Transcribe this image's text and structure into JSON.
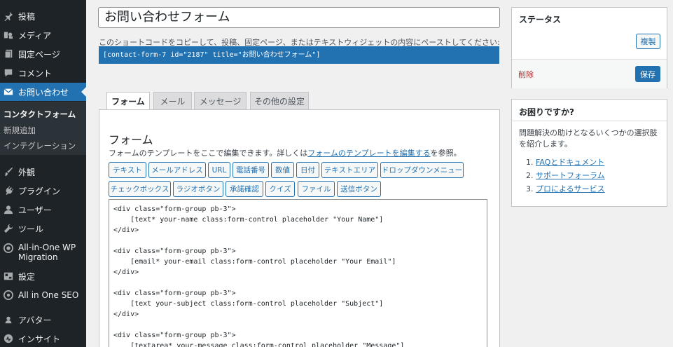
{
  "sidebar": {
    "items": [
      {
        "label": "投稿",
        "icon": "pin-icon"
      },
      {
        "label": "メディア",
        "icon": "media-icon"
      },
      {
        "label": "固定ページ",
        "icon": "page-icon"
      },
      {
        "label": "コメント",
        "icon": "comment-icon"
      },
      {
        "label": "お問い合わせ",
        "icon": "mail-icon"
      },
      {
        "label": "外観",
        "icon": "brush-icon"
      },
      {
        "label": "プラグイン",
        "icon": "plugin-icon"
      },
      {
        "label": "ユーザー",
        "icon": "user-icon"
      },
      {
        "label": "ツール",
        "icon": "wrench-icon"
      },
      {
        "label": "All-in-One WP",
        "label2": "Migration",
        "icon": "migration-icon"
      },
      {
        "label": "設定",
        "icon": "settings-icon"
      },
      {
        "label": "All in One SEO",
        "icon": "seo-icon"
      },
      {
        "label": "アバター",
        "icon": "avatar-icon"
      },
      {
        "label": "インサイト",
        "icon": "insights-icon"
      }
    ],
    "submenu": [
      "コンタクトフォーム",
      "新規追加",
      "インテグレーション"
    ]
  },
  "editor": {
    "title_value": "お問い合わせフォーム",
    "shortcode_desc": "このショートコードをコピーして、投稿、固定ページ、またはテキストウィジェットの内容にペーストしてください:",
    "shortcode": "[contact-form-7 id=\"2187\" title=\"お問い合わせフォーム\"]"
  },
  "tabs": [
    "フォーム",
    "メール",
    "メッセージ",
    "その他の設定"
  ],
  "form_panel": {
    "title": "フォーム",
    "desc_prefix": "フォームのテンプレートをここで編集できます。詳しくは",
    "desc_link": "フォームのテンプレートを編集する",
    "desc_suffix": "を参照。",
    "tag_buttons_row1": [
      "テキスト",
      "メールアドレス",
      "URL",
      "電話番号",
      "数値",
      "日付",
      "テキストエリア",
      "ドロップダウンメニュー"
    ],
    "tag_buttons_row2": [
      "チェックボックス",
      "ラジオボタン",
      "承諾確認",
      "クイズ",
      "ファイル",
      "送信ボタン"
    ],
    "code": "<div class=\"form-group pb-3\">\n    [text* your-name class:form-control placeholder \"Your Name\"]\n</div>\n\n<div class=\"form-group pb-3\">\n    [email* your-email class:form-control placeholder \"Your Email\"]\n</div>\n\n<div class=\"form-group pb-3\">\n    [text your-subject class:form-control placeholder \"Subject\"]\n</div>\n\n<div class=\"form-group pb-3\">\n    [textarea* your-message class:form-control placeholder \"Message\"]"
  },
  "status_box": {
    "title": "ステータス",
    "copy_label": "複製",
    "delete_label": "削除",
    "save_label": "保存"
  },
  "help_box": {
    "title": "お困りですか?",
    "desc": "問題解決の助けとなるいくつかの選択肢を紹介します。",
    "links": [
      {
        "num": "1.",
        "label": "FAQとドキュメント"
      },
      {
        "num": "2.",
        "label": "サポートフォーラム"
      },
      {
        "num": "3.",
        "label": "プロによるサービス"
      }
    ]
  },
  "colors": {
    "sidebar_bg": "#1d2327",
    "accent": "#2271b1",
    "delete": "#b32d2e"
  }
}
